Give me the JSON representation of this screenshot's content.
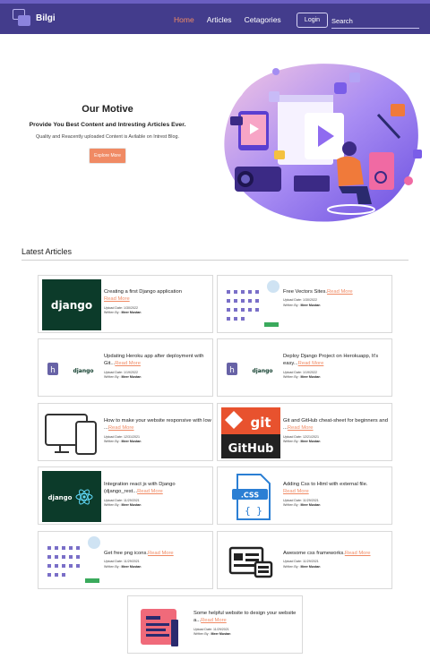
{
  "navbar": {
    "brand": "Bilgi",
    "links": [
      "Home",
      "Articles",
      "Cetagories"
    ],
    "login_label": "Login",
    "search_placeholder": "Search"
  },
  "hero": {
    "title": "Our Motive",
    "subtitle": "Provide You Best Content and Intresting Articles Ever.",
    "description": "Quality and Reacently uploaded Content is Avilable on Intrest Blog.",
    "button": "Explore More"
  },
  "latest": {
    "heading": "Latest Articles",
    "read_more": "Read More",
    "upload_label": "Upload Date:",
    "written_label": "Written By :",
    "articles": [
      {
        "title": "Creating a first Django application",
        "date": "1/30/2022",
        "author": "Meer Mustan",
        "thumb": "django-logo"
      },
      {
        "title": "Free Vectors Sites.",
        "date": "1/30/2022",
        "author": "Meer Mustan",
        "thumb": "icon-grid"
      },
      {
        "title": "Updating Heroku app after deployment with Git...",
        "date": "1/19/2022",
        "author": "Meer Mustan",
        "thumb": "heroku-django"
      },
      {
        "title": "Deploy Django Project on Herokuapp, It's easy...",
        "date": "1/19/2022",
        "author": "Meer Mustan",
        "thumb": "heroku-django"
      },
      {
        "title": "How to make your website responsive with low ...",
        "date": "12/31/2021",
        "author": "Meer Mustan",
        "thumb": "responsive-devices"
      },
      {
        "title": "Git and GitHub cheat-sheet for beginners and ...",
        "date": "12/21/2021",
        "author": "Meer Mustan",
        "thumb": "git-github"
      },
      {
        "title": "Integration react js with Django (django_rest...",
        "date": "11/29/2021",
        "author": "Meer Mustan",
        "thumb": "django-react"
      },
      {
        "title": "Adding Css to Html with external file.",
        "date": "11/29/2021",
        "author": "Meer Mustan",
        "thumb": "css-file"
      },
      {
        "title": "Get free png icons.",
        "date": "11/29/2021",
        "author": "Meer Mustan",
        "thumb": "icon-grid"
      },
      {
        "title": "Awesome css frameworks.",
        "date": "11/29/2021",
        "author": "Meer Mustan",
        "thumb": "web-layout"
      },
      {
        "title": "Some helpful website to design your website a...",
        "date": "11/29/2021",
        "author": "Meer Mustan",
        "thumb": "design-doc"
      }
    ]
  },
  "colors": {
    "navbar": "#433c8c",
    "accent": "#f08a64",
    "hero_blob": "#9f86f2",
    "django_green": "#0c3b2a"
  }
}
